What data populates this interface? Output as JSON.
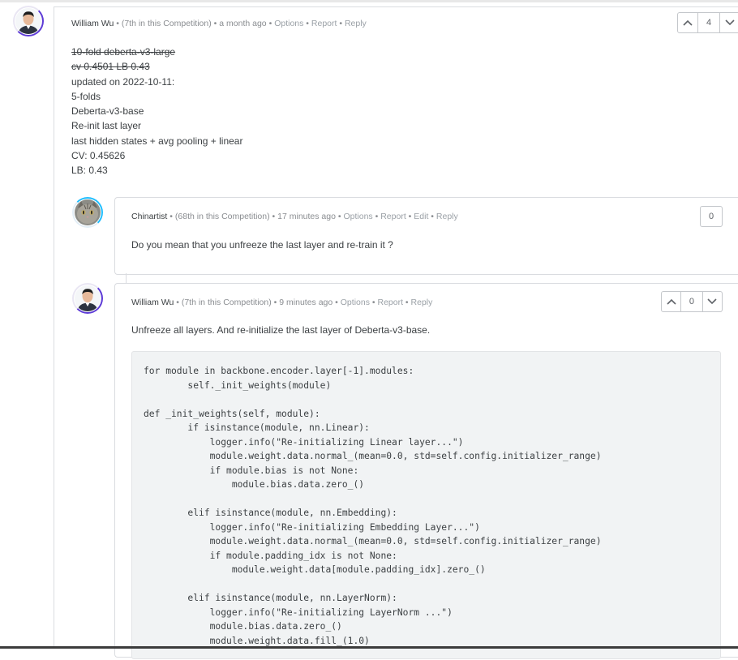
{
  "comments": [
    {
      "author": "William Wu",
      "rank": "(7th in this Competition)",
      "time": "a month ago",
      "actions": [
        "Options",
        "Report",
        "Reply"
      ],
      "votes": "4",
      "body": {
        "struck": [
          "10-fold deberta-v3-large",
          "cv 0.4501 LB 0.43"
        ],
        "lines": [
          "updated on 2022-10-11:",
          "5-folds",
          "Deberta-v3-base",
          "Re-init last layer",
          "last hidden states + avg pooling + linear",
          "CV: 0.45626",
          "LB: 0.43"
        ]
      }
    },
    {
      "author": "Chinartist",
      "rank": "(68th in this Competition)",
      "time": "17 minutes ago",
      "actions": [
        "Options",
        "Report",
        "Edit",
        "Reply"
      ],
      "votes": "0",
      "body": "Do you mean that you unfreeze the last layer and re-train it ?"
    },
    {
      "author": "William Wu",
      "rank": "(7th in this Competition)",
      "time": "9 minutes ago",
      "actions": [
        "Options",
        "Report",
        "Reply"
      ],
      "votes": "0",
      "body": "Unfreeze all layers. And re-initialize the last layer of Deberta-v3-base.",
      "code": "for module in backbone.encoder.layer[-1].modules:\n        self._init_weights(module)\n\ndef _init_weights(self, module):\n        if isinstance(module, nn.Linear):\n            logger.info(\"Re-initializing Linear layer...\")\n            module.weight.data.normal_(mean=0.0, std=self.config.initializer_range)\n            if module.bias is not None:\n                module.bias.data.zero_()\n\n        elif isinstance(module, nn.Embedding):\n            logger.info(\"Re-initializing Embedding Layer...\")\n            module.weight.data.normal_(mean=0.0, std=self.config.initializer_range)\n            if module.padding_idx is not None:\n                module.weight.data[module.padding_idx].zero_()\n\n        elif isinstance(module, nn.LayerNorm):\n            logger.info(\"Re-initializing LayerNorm ...\")\n            module.bias.data.zero_()\n            module.weight.data.fill_(1.0)"
    }
  ],
  "separator": "•",
  "colors": {
    "ring_purple": "#5d3bd6",
    "ring_blue": "#20beff",
    "border": "#dadce0",
    "code_bg": "#f1f3f4"
  }
}
